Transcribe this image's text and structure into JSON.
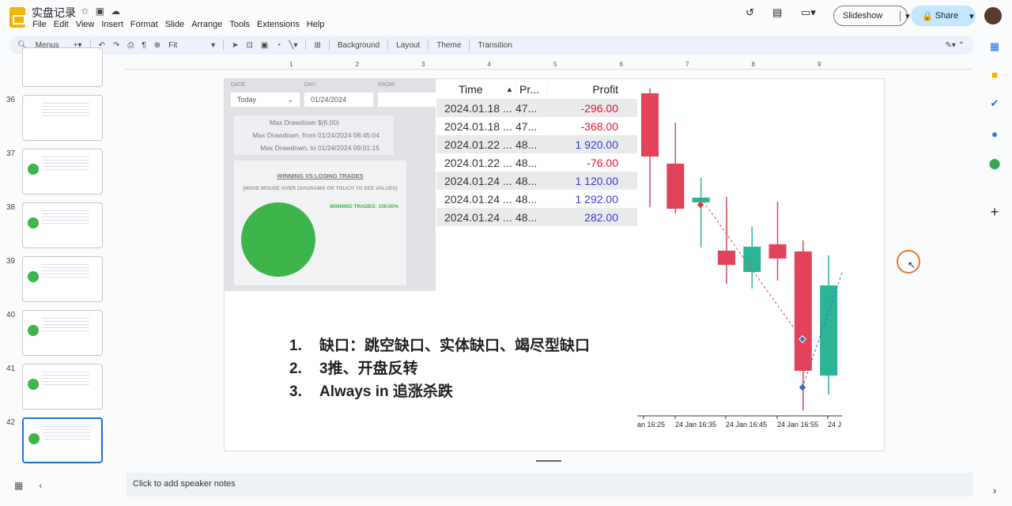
{
  "app": {
    "doc_title": "实盘记录",
    "menus": [
      "File",
      "Edit",
      "View",
      "Insert",
      "Format",
      "Slide",
      "Arrange",
      "Tools",
      "Extensions",
      "Help"
    ],
    "slideshow": "Slideshow",
    "share": "Share"
  },
  "toolbar": {
    "menus_search": "Menus",
    "zoom": "Fit",
    "background": "Background",
    "layout": "Layout",
    "theme": "Theme",
    "transition": "Transition"
  },
  "ruler": [
    "1",
    "2",
    "3",
    "4",
    "5",
    "6",
    "7",
    "8",
    "9"
  ],
  "slides": [
    "36",
    "37",
    "38",
    "39",
    "40",
    "41",
    "42"
  ],
  "panel": {
    "date_label": "DATE",
    "day_label": "DAY:",
    "from_label": "FROM:",
    "date_value": "Today",
    "day_value": "01/24/2024",
    "drawdown": [
      {
        "label": "Max Drawdown",
        "value": "$(6.00)"
      },
      {
        "label": "Max Drawdown, from",
        "value": "01/24/2024 08:45:04"
      },
      {
        "label": "Max Drawdown, to",
        "value": "01/24/2024 09:01:15"
      }
    ],
    "win_title": "WINNING VS LOSING TRADES",
    "win_hint": "(MOVE MOUSE OVER DIAGRAMS OR TOUCH TO SEE VALUES)",
    "win_pct": "WINNING TRADES: 100.00%"
  },
  "table": {
    "headers": [
      "Time",
      "Pr...",
      "Profit"
    ],
    "rows": [
      [
        "2024.01.18 ...",
        "47...",
        "-296.00"
      ],
      [
        "2024.01.18 ...",
        "47...",
        "-368.00"
      ],
      [
        "2024.01.22 ...",
        "48...",
        "1 920.00"
      ],
      [
        "2024.01.22 ...",
        "48...",
        "-76.00"
      ],
      [
        "2024.01.24 ...",
        "48...",
        "1 120.00"
      ],
      [
        "2024.01.24 ...",
        "48...",
        "1 292.00"
      ],
      [
        "2024.01.24 ...",
        "48...",
        "282.00"
      ]
    ]
  },
  "list": [
    {
      "n": "1.",
      "t": "缺口：跳空缺口、实体缺口、竭尽型缺口"
    },
    {
      "n": "2.",
      "t": "3推、开盘反转"
    },
    {
      "n": "3.",
      "t": "Always in 追涨杀跌"
    }
  ],
  "notes": "Click to add speaker notes",
  "colors": {
    "up": "#2bb596",
    "down": "#e2425a",
    "win": "#3db54a"
  },
  "chart_data": {
    "type": "candlestick",
    "ylim": [
      8,
      49
    ],
    "xticks": [
      "an 16:25",
      "24 Jan 16:35",
      "24 Jan 16:45",
      "24 Jan 16:55",
      "24 J"
    ],
    "candles": [
      {
        "o": 48.2,
        "h": 48.8,
        "l": 33.8,
        "c": 40.2
      },
      {
        "o": 39.3,
        "h": 44.5,
        "l": 33.0,
        "c": 33.6
      },
      {
        "o": 34.4,
        "h": 37.5,
        "l": 28.7,
        "c": 35.0
      },
      {
        "o": 28.3,
        "h": 35.1,
        "l": 24.1,
        "c": 26.5
      },
      {
        "o": 25.6,
        "h": 31.3,
        "l": 23.5,
        "c": 28.8
      },
      {
        "o": 29.1,
        "h": 34.5,
        "l": 24.5,
        "c": 27.3
      },
      {
        "o": 28.2,
        "h": 29.6,
        "l": 8.1,
        "c": 13.1
      },
      {
        "o": 12.5,
        "h": 27.7,
        "l": 10.1,
        "c": 23.9
      }
    ]
  }
}
